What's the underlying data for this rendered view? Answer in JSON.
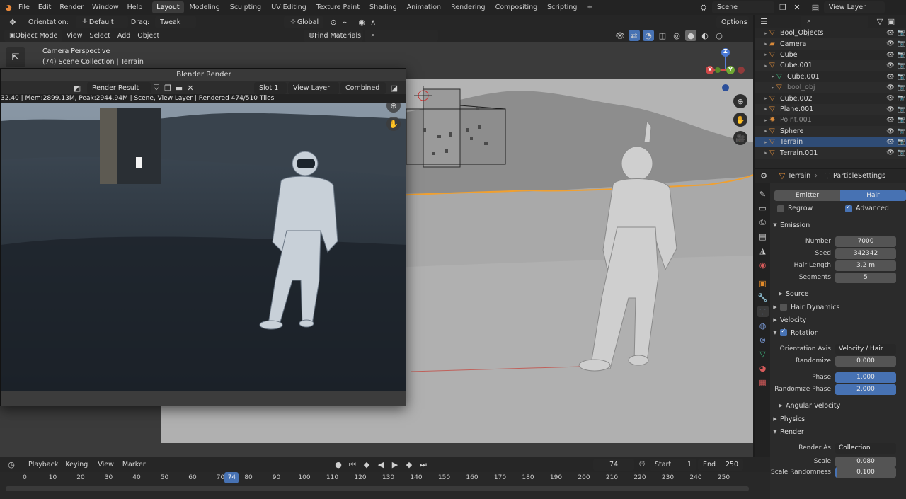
{
  "topbar": {
    "menus": [
      "File",
      "Edit",
      "Render",
      "Window",
      "Help"
    ],
    "workspaces": [
      "Layout",
      "Modeling",
      "Sculpting",
      "UV Editing",
      "Texture Paint",
      "Shading",
      "Animation",
      "Rendering",
      "Compositing",
      "Scripting"
    ],
    "active_workspace": "Layout",
    "scene": "Scene",
    "view_layer": "View Layer"
  },
  "viewport": {
    "orientation_label": "Orientation:",
    "orientation_value": "Default",
    "drag_label": "Drag:",
    "drag_value": "Tweak",
    "transform_space": "Global",
    "options": "Options",
    "mode": "Object Mode",
    "menus": [
      "View",
      "Select",
      "Add",
      "Object"
    ],
    "find_materials": "Find Materials",
    "camera_title": "Camera Perspective",
    "camera_subtitle": "(74) Scene Collection | Terrain",
    "gizmo": {
      "z": "Z",
      "y": "Y",
      "x": "X"
    }
  },
  "render_window": {
    "title": "Blender Render",
    "image_name": "Render Result",
    "slot": "Slot 1",
    "view_layer": "View Layer",
    "pass": "Combined",
    "status": "32.40 | Mem:2899.13M, Peak:2944.94M | Scene, View Layer | Rendered 474/510 Tiles"
  },
  "outliner": {
    "rows": [
      {
        "label": "Bool_Objects",
        "indent": 1,
        "muted": false,
        "selected": false,
        "icon": "collection"
      },
      {
        "label": "Camera",
        "indent": 1,
        "muted": false,
        "selected": false,
        "icon": "camera"
      },
      {
        "label": "Cube",
        "indent": 1,
        "muted": false,
        "selected": false,
        "icon": "mesh"
      },
      {
        "label": "Cube.001",
        "indent": 1,
        "muted": false,
        "selected": false,
        "icon": "mesh"
      },
      {
        "label": "Cube.001",
        "indent": 2,
        "muted": false,
        "selected": false,
        "icon": "mesh-data"
      },
      {
        "label": "bool_obj",
        "indent": 2,
        "muted": true,
        "selected": false,
        "icon": "mesh"
      },
      {
        "label": "Cube.002",
        "indent": 1,
        "muted": false,
        "selected": false,
        "icon": "mesh"
      },
      {
        "label": "Plane.001",
        "indent": 1,
        "muted": false,
        "selected": false,
        "icon": "mesh"
      },
      {
        "label": "Point.001",
        "indent": 1,
        "muted": true,
        "selected": false,
        "icon": "light"
      },
      {
        "label": "Sphere",
        "indent": 1,
        "muted": false,
        "selected": false,
        "icon": "mesh"
      },
      {
        "label": "Terrain",
        "indent": 1,
        "muted": false,
        "selected": true,
        "icon": "mesh"
      },
      {
        "label": "Terrain.001",
        "indent": 1,
        "muted": false,
        "selected": false,
        "icon": "mesh"
      }
    ]
  },
  "properties": {
    "object": "Terrain",
    "particle_settings": "ParticleSettings",
    "type_emitter": "Emitter",
    "type_hair": "Hair",
    "regrow": "Regrow",
    "advanced": "Advanced",
    "emission": {
      "title": "Emission",
      "number_label": "Number",
      "number": "7000",
      "seed_label": "Seed",
      "seed": "342342",
      "hair_length_label": "Hair Length",
      "hair_length": "3.2 m",
      "segments_label": "Segments",
      "segments": "5"
    },
    "source": "Source",
    "hair_dynamics": "Hair Dynamics",
    "velocity": "Velocity",
    "rotation": {
      "title": "Rotation",
      "orientation_axis_label": "Orientation Axis",
      "orientation_axis": "Velocity / Hair",
      "randomize_label": "Randomize",
      "randomize": "0.000",
      "phase_label": "Phase",
      "phase": "1.000",
      "randomize_phase_label": "Randomize Phase",
      "randomize_phase": "2.000",
      "angular_velocity": "Angular Velocity"
    },
    "physics": "Physics",
    "render": {
      "title": "Render",
      "render_as_label": "Render As",
      "render_as": "Collection",
      "scale_label": "Scale",
      "scale": "0.080",
      "scale_randomness_label": "Scale Randomness",
      "scale_randomness": "0.100"
    }
  },
  "timeline": {
    "menus": [
      "Playback",
      "Keying",
      "View",
      "Marker"
    ],
    "current_frame": "74",
    "start_label": "Start",
    "start": "1",
    "end_label": "End",
    "end": "250",
    "ticks": [
      "0",
      "10",
      "20",
      "30",
      "40",
      "50",
      "60",
      "70",
      "80",
      "90",
      "100",
      "110",
      "120",
      "130",
      "140",
      "150",
      "160",
      "170",
      "180",
      "190",
      "200",
      "210",
      "220",
      "230",
      "240",
      "250"
    ]
  },
  "colors": {
    "accent_blue": "#4772b3",
    "selection_orange": "#f0a030",
    "mesh_icon": "#d98a3a",
    "modifier_icon": "#7a9ad6",
    "data_icon": "#3fbf84"
  }
}
